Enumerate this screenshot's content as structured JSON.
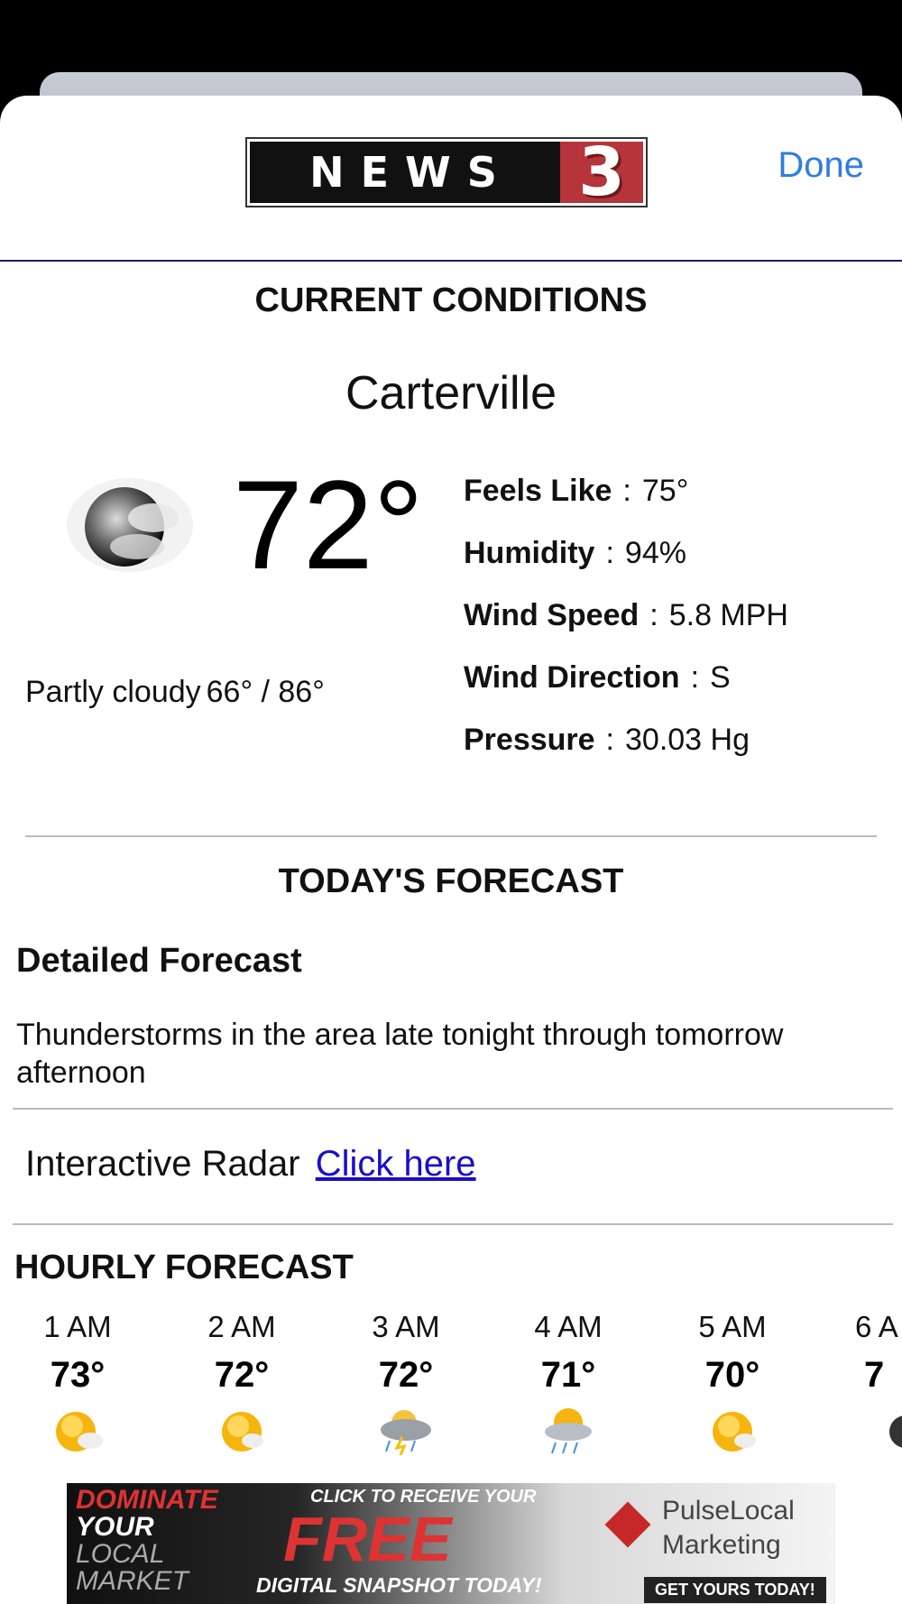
{
  "nav": {
    "logo_text": "NEWS",
    "logo_number": "3",
    "done_label": "Done"
  },
  "current": {
    "section_title": "CURRENT CONDITIONS",
    "city": "Carterville",
    "temperature": "72°",
    "condition": "Partly cloudy",
    "hi_lo": "66° / 86°",
    "details": [
      {
        "key": "Feels Like",
        "value": "75°"
      },
      {
        "key": "Humidity",
        "value": "94%"
      },
      {
        "key": "Wind Speed",
        "value": "5.8 MPH"
      },
      {
        "key": "Wind Direction",
        "value": "S"
      },
      {
        "key": "Pressure",
        "value": "30.03 Hg"
      }
    ],
    "separator": ":"
  },
  "today": {
    "section_title": "TODAY'S FORECAST",
    "detailed_heading": "Detailed Forecast",
    "detailed_text": "Thunderstorms in the area late tonight through tomorrow afternoon"
  },
  "radar": {
    "label": "Interactive Radar",
    "link_text": "Click here"
  },
  "hourly": {
    "title": "HOURLY FORECAST",
    "items": [
      {
        "time": "1 AM",
        "temp": "73°",
        "icon": "sun-cloud-icon"
      },
      {
        "time": "2 AM",
        "temp": "72°",
        "icon": "sun-cloud-icon"
      },
      {
        "time": "3 AM",
        "temp": "72°",
        "icon": "thunderstorm-icon"
      },
      {
        "time": "4 AM",
        "temp": "71°",
        "icon": "rain-sun-icon"
      },
      {
        "time": "5 AM",
        "temp": "70°",
        "icon": "sun-cloud-icon"
      },
      {
        "time": "6 A",
        "temp": "7",
        "icon": "moon-cloud-icon"
      }
    ]
  },
  "ad": {
    "line1": "DOMINATE",
    "line2": "YOUR",
    "line3": "LOCAL",
    "line4": "MARKET",
    "cta_top": "CLICK TO RECEIVE YOUR",
    "free": "FREE",
    "cta_bottom": "DIGITAL SNAPSHOT TODAY!",
    "brand_line1": "PulseLocal",
    "brand_line2": "Marketing",
    "cta_button": "GET YOURS TODAY!"
  }
}
